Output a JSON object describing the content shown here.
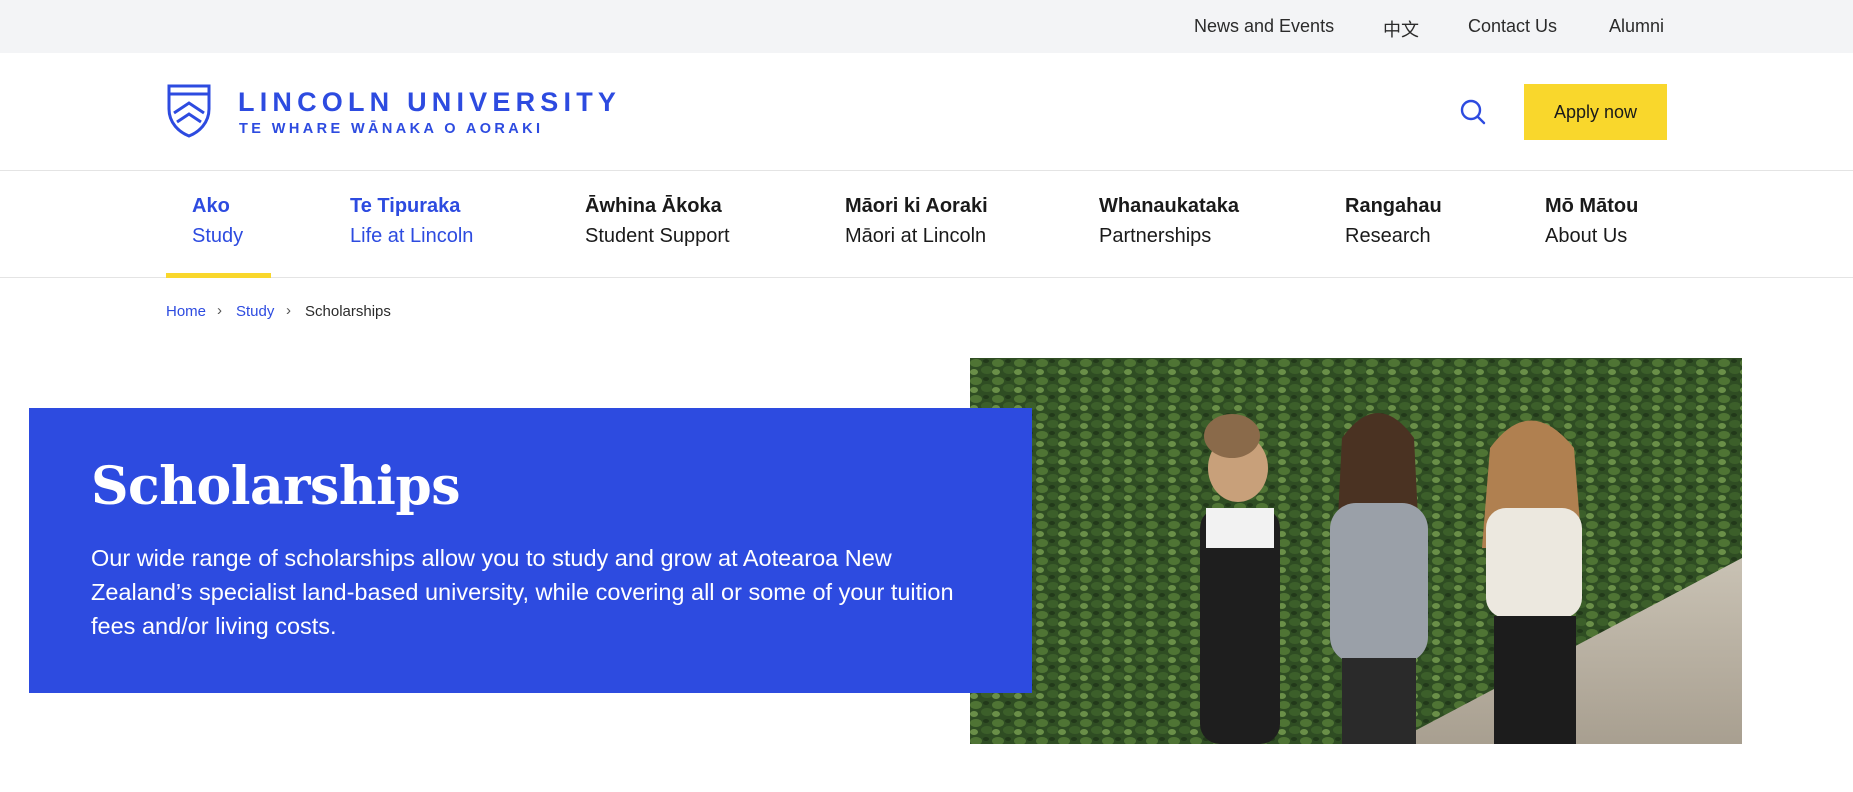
{
  "utility_nav": {
    "items": [
      {
        "label": "News and Events"
      },
      {
        "label": "中文"
      },
      {
        "label": "Contact Us"
      },
      {
        "label": "Alumni"
      }
    ]
  },
  "header": {
    "logo_title": "LINCOLN UNIVERSITY",
    "logo_subtitle": "TE WHARE WĀNAKA O AORAKI",
    "search_icon": "search-icon",
    "apply_label": "Apply now"
  },
  "main_nav": {
    "items": [
      {
        "maori": "Ako",
        "english": "Study",
        "active": true
      },
      {
        "maori": "Te Tipuraka",
        "english": "Life at Lincoln"
      },
      {
        "maori": "Āwhina Ākoka",
        "english": "Student Support"
      },
      {
        "maori": "Māori ki Aoraki",
        "english": "Māori at Lincoln"
      },
      {
        "maori": "Whanaukataka",
        "english": "Partnerships"
      },
      {
        "maori": "Rangahau",
        "english": "Research"
      },
      {
        "maori": "Mō Mātou",
        "english": "About Us"
      }
    ]
  },
  "breadcrumb": {
    "items": [
      "Home",
      "Study"
    ],
    "current": "Scholarships"
  },
  "hero": {
    "title": "Scholarships",
    "description": "Our wide range of scholarships allow you to study and grow at Aotearoa New Zealand’s specialist land-based university, while covering all or some of your tuition fees and/or living costs."
  },
  "colors": {
    "brand_blue": "#2d4be0",
    "accent_yellow": "#f9d72c",
    "utility_bg": "#f3f4f6"
  }
}
